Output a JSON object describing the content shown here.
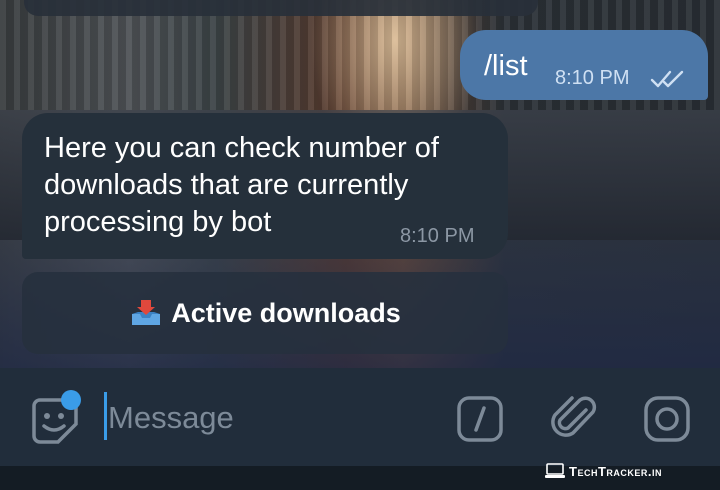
{
  "chat": {
    "outgoing": {
      "text": "/list",
      "time": "8:10 PM",
      "status_icon": "double-check-icon"
    },
    "incoming": {
      "text": "Here you can check number of downloads that are currently processing by bot",
      "time": "8:10 PM"
    },
    "keyboard_button": {
      "emoji": "inbox-tray-icon",
      "label": "Active downloads"
    }
  },
  "input_bar": {
    "placeholder": "Message",
    "value": "",
    "icons": [
      "sticker-icon",
      "bot-command-icon",
      "paperclip-icon",
      "camera-icon"
    ]
  },
  "watermark": {
    "text": "TechTracker.in"
  },
  "colors": {
    "outgoing_bubble": "#4c77a7",
    "incoming_bubble": "#25303b",
    "input_bar": "#212d3b",
    "accent": "#3a9ce8"
  }
}
